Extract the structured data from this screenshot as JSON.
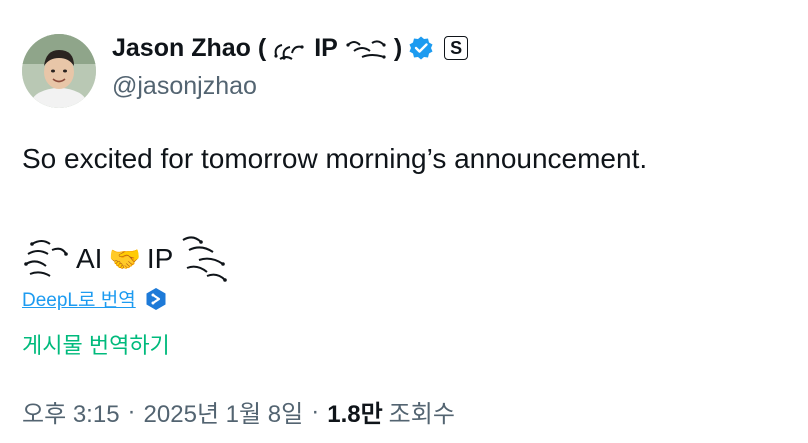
{
  "author": {
    "name": "Jason Zhao (",
    "name_mid": "IP",
    "name_close": ")",
    "handle": "@jasonjzhao",
    "verified_color": "#1d9bf0",
    "badge_label": "S"
  },
  "tweet": {
    "text": "So excited for tomorrow morning’s announcement.",
    "ai_text": "AI",
    "handshake": "🤝",
    "ip_text": "IP"
  },
  "translation": {
    "deepl_label": "DeepL로 번역",
    "translate_post_label": "게시물 번역하기"
  },
  "meta": {
    "time": "오후 3:15",
    "dot1": "·",
    "date": "2025년 1월 8일",
    "dot2": "·",
    "views_count": "1.8만",
    "views_label": "조회수"
  },
  "colors": {
    "accent": "#1d9bf0",
    "translate": "#00ba7c",
    "secondary_text": "#536471"
  }
}
